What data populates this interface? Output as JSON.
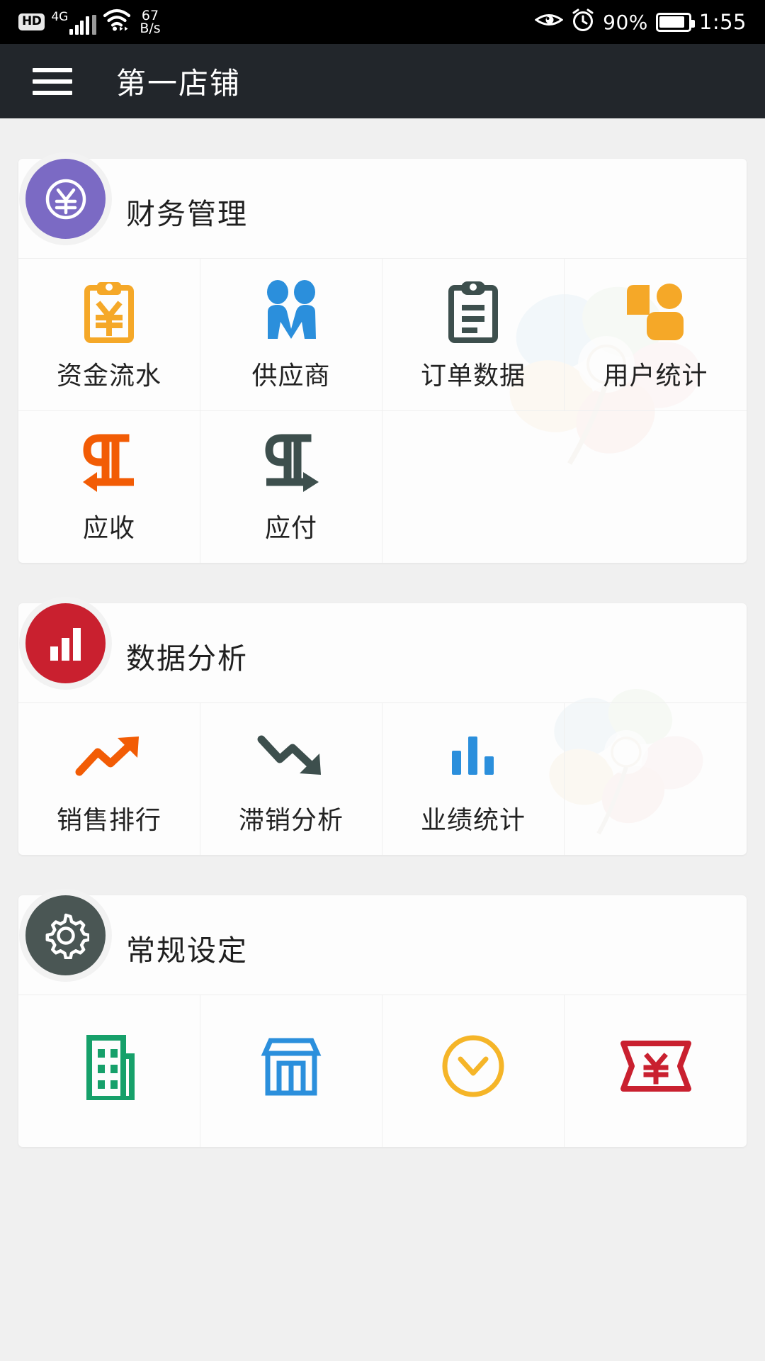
{
  "status_bar": {
    "hd_label": "HD",
    "network_type": "4G",
    "data_speed_value": "67",
    "data_speed_unit": "B/s",
    "eye_icon": "eye-icon",
    "alarm_icon": "alarm-clock-icon",
    "battery_percent": "90%",
    "battery_level": 90,
    "time": "1:55"
  },
  "header": {
    "menu_icon": "hamburger-menu-icon",
    "title": "第一店铺"
  },
  "sections": [
    {
      "id": "finance",
      "title": "财务管理",
      "badge_icon": "yen-circle-icon",
      "badge_color": "#7b6ac4",
      "items": [
        {
          "label": "资金流水",
          "icon": "clipboard-yen-icon",
          "color": "#f5a828"
        },
        {
          "label": "供应商",
          "icon": "handshake-people-icon",
          "color": "#2b8fdc"
        },
        {
          "label": "订单数据",
          "icon": "clipboard-lines-icon",
          "color": "#3d4f4d"
        },
        {
          "label": "用户统计",
          "icon": "user-stats-shapes-icon",
          "color": "#f5a828"
        },
        {
          "label": "应收",
          "icon": "pilcrow-left-arrow-icon",
          "color": "#f25c05"
        },
        {
          "label": "应付",
          "icon": "pilcrow-right-arrow-icon",
          "color": "#3d4f4d"
        }
      ]
    },
    {
      "id": "analytics",
      "title": "数据分析",
      "badge_icon": "bar-chart-icon",
      "badge_color": "#c9202f",
      "items": [
        {
          "label": "销售排行",
          "icon": "trend-up-arrow-icon",
          "color": "#f25c05"
        },
        {
          "label": "滞销分析",
          "icon": "trend-down-arrow-icon",
          "color": "#3d4f4d"
        },
        {
          "label": "业绩统计",
          "icon": "bar-columns-icon",
          "color": "#2b8fdc"
        }
      ]
    },
    {
      "id": "settings",
      "title": "常规设定",
      "badge_icon": "gear-icon",
      "badge_color": "#4a5654",
      "items": [
        {
          "label": "",
          "icon": "building-icon",
          "color": "#16a06a"
        },
        {
          "label": "",
          "icon": "storefront-icon",
          "color": "#2b8fdc"
        },
        {
          "label": "",
          "icon": "chevron-down-circle-icon",
          "color": "#f5b528"
        },
        {
          "label": "",
          "icon": "yen-ticket-icon",
          "color": "#c9202f"
        }
      ]
    }
  ],
  "colors": {
    "page_background": "#f0f0f0",
    "card_background": "#fdfdfd",
    "header_background": "#22262b",
    "status_bar_background": "#000000",
    "text_primary": "#1f1f1f"
  }
}
